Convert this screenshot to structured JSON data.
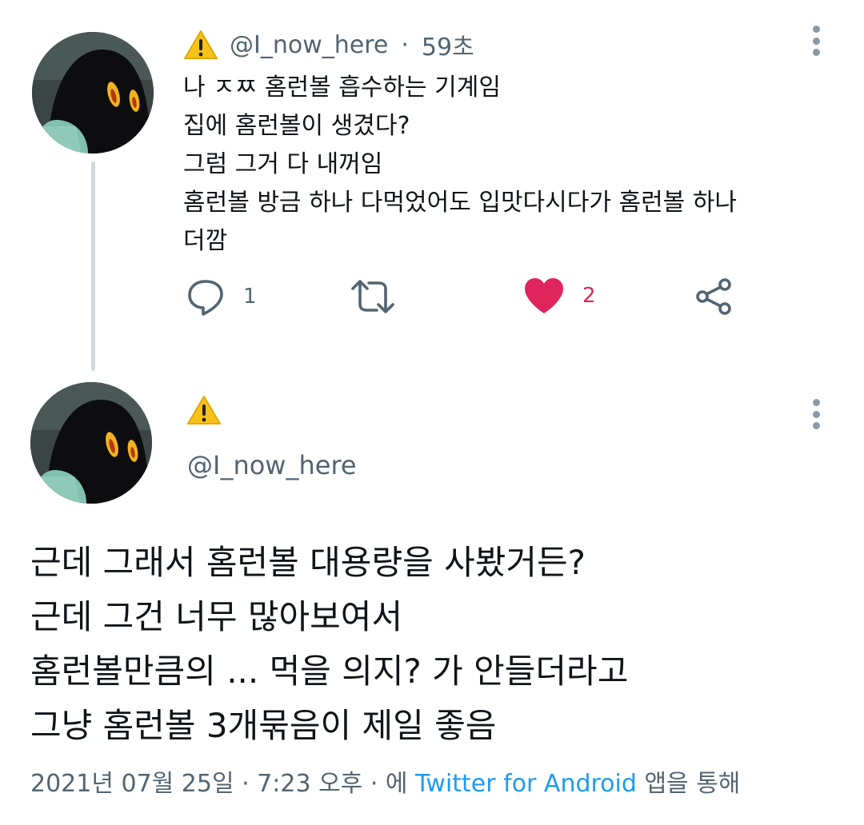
{
  "colors": {
    "accent": "#1d9bf0",
    "like": "#e0245e",
    "secondary_text": "#536471",
    "primary_text": "#0f1419",
    "thread_line": "#cfd9de"
  },
  "tweet1": {
    "handle": "@I_now_here",
    "separator": "·",
    "time": "59초",
    "lines": [
      "나 ㅈㅉ 홈런볼 흡수하는 기계임",
      "집에 홈런볼이 생겼다?",
      "그럼 그거 다 내꺼임",
      "홈런볼 방금 하나 다먹었어도 입맛다시다가 홈런볼 하나",
      "더깜"
    ],
    "actions": {
      "reply_icon": "reply-icon",
      "reply_count": "1",
      "retweet_icon": "retweet-icon",
      "like_icon": "heart-icon",
      "like_count": "2",
      "share_icon": "share-icon"
    }
  },
  "tweet2": {
    "handle": "@I_now_here",
    "lines": [
      "근데 그래서 홈런볼 대용량을 사봤거든?",
      "근데 그건 너무 많아보여서",
      "홈런볼만큼의 ... 먹을 의지? 가 안들더라고",
      "그냥 홈런볼 3개묶음이 제일 좋음"
    ],
    "timestamp": "2021년 07월 25일 · 7:23 오후 · 에",
    "source_link": "Twitter for Android",
    "source_suffix": "앱을 통해"
  }
}
